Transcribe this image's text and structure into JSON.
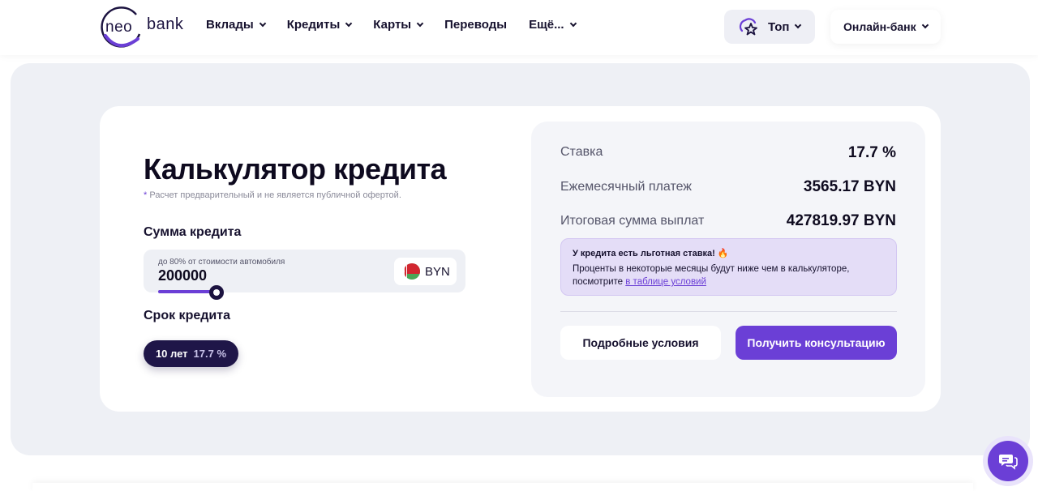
{
  "brand": {
    "logo_neo": "neo",
    "logo_bank": "bank",
    "accent": "#6b3fd6",
    "dark": "#1f1648"
  },
  "header": {
    "nav": [
      {
        "label": "Вклады",
        "dropdown": true
      },
      {
        "label": "Кредиты",
        "dropdown": true
      },
      {
        "label": "Карты",
        "dropdown": true
      },
      {
        "label": "Переводы",
        "dropdown": false
      },
      {
        "label": "Ещё...",
        "dropdown": true
      }
    ],
    "top_button": "Топ",
    "online_bank": "Онлайн-банк"
  },
  "calculator": {
    "title": "Калькулятор кредита",
    "disclaimer_mark": "*",
    "disclaimer": "Расчет предварительный и не является публичной офертой.",
    "sum_label": "Сумма кредита",
    "sum_hint": "до 80% от стоимости автомобиля",
    "sum_value": "200000",
    "currency": "BYN",
    "term_label": "Срок кредита",
    "term_option": "10 лет",
    "term_rate": "17.7 %"
  },
  "results": {
    "rate_label": "Ставка",
    "rate_value": "17.7 %",
    "monthly_label": "Ежемесячный платеж",
    "monthly_value": "3565.17 BYN",
    "total_label": "Итоговая сумма выплат",
    "total_value": "427819.97 BYN",
    "promo_title": "У кредита есть льготная ставка! 🔥",
    "promo_text": "Проценты в некоторые месяцы будут ниже чем в калькуляторе, посмотрите ",
    "promo_link": "в таблице условий",
    "details_button": "Подробные условия",
    "consult_button": "Получить консультацию"
  },
  "icons": {
    "logo": "neobank-logo-ring",
    "top": "star-cloud-icon",
    "chat": "chat-bubbles-icon",
    "flag": "belarus-flag-icon"
  }
}
